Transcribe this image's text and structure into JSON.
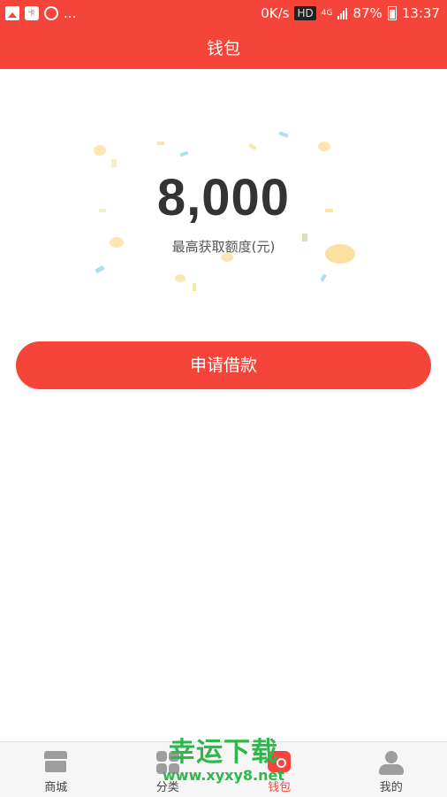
{
  "status_bar": {
    "more": "...",
    "speed": "0K/s",
    "hd": "HD",
    "network": "4G",
    "battery": "87%",
    "time": "13:37"
  },
  "header": {
    "title": "钱包"
  },
  "credit": {
    "amount": "8,000",
    "label": "最高获取额度(元)"
  },
  "apply_button": {
    "label": "申请借款"
  },
  "tabbar": {
    "items": [
      {
        "label": "商城",
        "icon": "shop-icon",
        "active": false
      },
      {
        "label": "分类",
        "icon": "category-icon",
        "active": false
      },
      {
        "label": "钱包",
        "icon": "wallet-icon",
        "active": true
      },
      {
        "label": "我的",
        "icon": "user-icon",
        "active": false
      }
    ]
  },
  "watermark": {
    "title": "幸运下载",
    "url": "www.xyxy8.net"
  },
  "colors": {
    "primary": "#f5453a",
    "text_dark": "#333333",
    "tab_inactive": "#9d9d9d",
    "watermark": "#2fb84a"
  }
}
